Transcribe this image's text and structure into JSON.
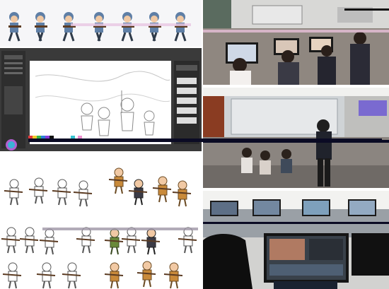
{
  "collage": {
    "tiles": [
      {
        "id": "sprite-sheet",
        "subject": "soldier-run-cycle-sprites"
      },
      {
        "id": "drawing-app",
        "subject": "digital-painting-software-lineart"
      },
      {
        "id": "computer-lab-students",
        "subject": "students-at-computers"
      },
      {
        "id": "classroom-teacher",
        "subject": "teacher-in-classroom"
      },
      {
        "id": "character-sketches",
        "subject": "cartoon-soldier-character-designs"
      },
      {
        "id": "lab-video-editing",
        "subject": "student-editing-video"
      }
    ]
  },
  "colors": {
    "khaki_uniform": "#c98a3a",
    "blue_uniform": "#5f7fa6",
    "app_dark": "#3a3a3a",
    "lab_floor": "#9a8f86",
    "glitch": "#0b0b24"
  }
}
